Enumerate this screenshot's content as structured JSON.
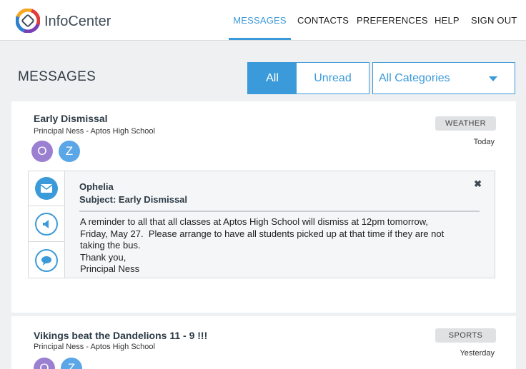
{
  "app": {
    "brand": "InfoCenter"
  },
  "nav": {
    "items": [
      {
        "label": "MESSAGES",
        "active": true
      },
      {
        "label": "CONTACTS",
        "active": false
      },
      {
        "label": "PREFERENCES",
        "active": false
      },
      {
        "label": "HELP",
        "active": false
      },
      {
        "label": "SIGN OUT",
        "active": false
      }
    ]
  },
  "page": {
    "title": "MESSAGES",
    "filter": {
      "all_label": "All",
      "unread_label": "Unread",
      "selected": "All"
    },
    "category_select": {
      "value": "All Categories"
    }
  },
  "messages": [
    {
      "title": "Early Dismissal",
      "sender": "Principal Ness - Aptos High School",
      "category": "WEATHER",
      "date": "Today",
      "recipients": [
        {
          "initial": "O",
          "color": "#9b7fd1"
        },
        {
          "initial": "Z",
          "color": "#5aa6e6"
        }
      ],
      "detail": {
        "from": "Ophelia",
        "subject": "Subject: Early Dismissal",
        "close_symbol": "✖",
        "body_lines": [
          "A reminder to all that all classes at Aptos High School will dismiss at 12pm tomorrow,",
          "Friday, May 27.  Please arrange to have all students picked up at that time if they are not",
          "taking the bus.",
          "Thank you,",
          "Principal Ness"
        ],
        "channels": [
          "envelope-icon",
          "megaphone-icon",
          "chat-bubble-icon"
        ]
      }
    },
    {
      "title": "Vikings beat the Dandelions 11 - 9 !!!",
      "sender": "Principal Ness - Aptos High School",
      "category": "SPORTS",
      "date": "Yesterday",
      "recipients": [
        {
          "initial": "O",
          "color": "#9b7fd1"
        },
        {
          "initial": "Z",
          "color": "#5aa6e6"
        }
      ]
    }
  ],
  "colors": {
    "accent": "#3b9ad9",
    "badge_bg": "#dfe1e3"
  }
}
